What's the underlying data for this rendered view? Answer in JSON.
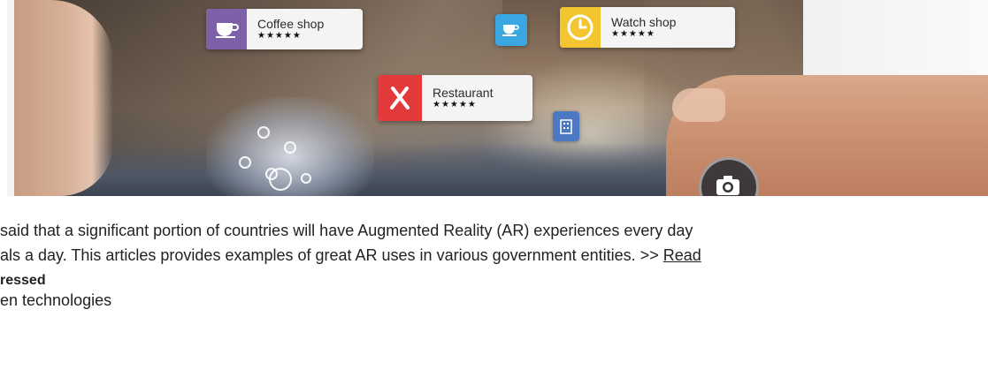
{
  "hero": {
    "labels": [
      {
        "name": "Coffee shop",
        "stars": "★★★★★",
        "color": "#7d61a8"
      },
      {
        "name": "Watch shop",
        "stars": "★★★★★",
        "color": "#f2c531"
      },
      {
        "name": "Restaurant",
        "stars": "★★★★★",
        "color": "#e23a3a"
      }
    ],
    "mini_card_color": "#3aa6e2",
    "mini_card_2_color": "#4c78c4"
  },
  "article": {
    "line1": " said that a significant portion of countries will have Augmented Reality (AR) experiences every day",
    "line2_prefix": "als a day. This articles provides examples of great AR uses in various government entities. >> ",
    "read_more": "Read",
    "section_title": "ressed",
    "list_item": "en technologies"
  }
}
